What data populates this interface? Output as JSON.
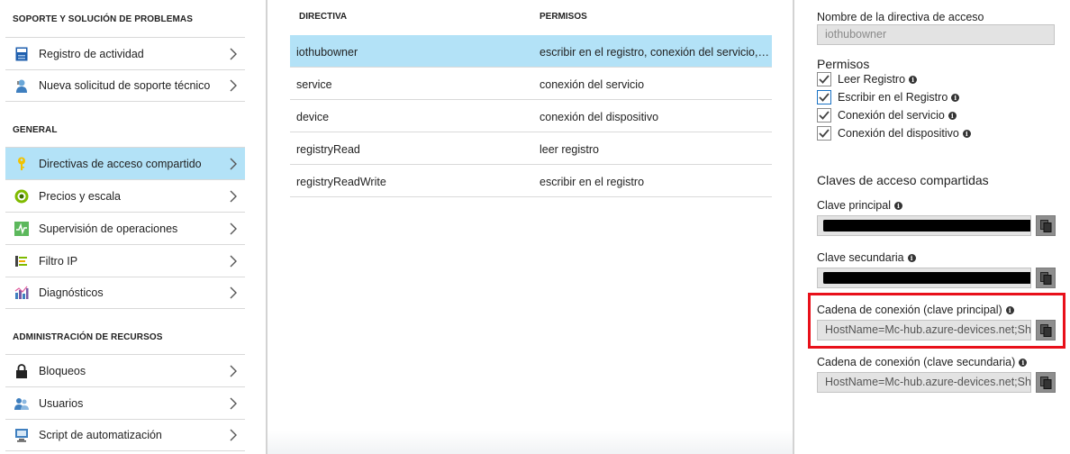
{
  "nav": {
    "sections": [
      {
        "title": "SOPORTE Y SOLUCIÓN DE PROBLEMAS",
        "items": [
          {
            "label": "Registro de actividad",
            "icon": "activity-log-icon"
          },
          {
            "label": "Nueva solicitud de soporte técnico",
            "icon": "support-request-icon"
          }
        ]
      },
      {
        "title": "GENERAL",
        "items": [
          {
            "label": "Directivas de acceso compartido",
            "icon": "key-icon",
            "active": true
          },
          {
            "label": "Precios y escala",
            "icon": "pricing-icon"
          },
          {
            "label": "Supervisión de operaciones",
            "icon": "monitoring-icon"
          },
          {
            "label": "Filtro IP",
            "icon": "ip-filter-icon"
          },
          {
            "label": "Diagnósticos",
            "icon": "diagnostics-icon"
          }
        ]
      },
      {
        "title": "ADMINISTRACIÓN DE RECURSOS",
        "items": [
          {
            "label": "Bloqueos",
            "icon": "lock-icon"
          },
          {
            "label": "Usuarios",
            "icon": "users-icon"
          },
          {
            "label": "Script de automatización",
            "icon": "automation-script-icon"
          }
        ]
      }
    ]
  },
  "table": {
    "headers": {
      "name": "DIRECTIVA",
      "permissions": "PERMISOS"
    },
    "rows": [
      {
        "name": "iothubowner",
        "permissions": "escribir en el registro, conexión del servicio, co..."
      },
      {
        "name": "service",
        "permissions": "conexión del servicio"
      },
      {
        "name": "device",
        "permissions": "conexión del dispositivo"
      },
      {
        "name": "registryRead",
        "permissions": "leer registro"
      },
      {
        "name": "registryReadWrite",
        "permissions": "escribir en el registro"
      }
    ],
    "selected_index": 0
  },
  "details": {
    "policy_name_label": "Nombre de la directiva de acceso",
    "policy_name_value": "iothubowner",
    "permissions_title": "Permisos",
    "permissions": [
      {
        "label": "Leer Registro",
        "checked": true
      },
      {
        "label": "Escribir en el Registro",
        "checked": true
      },
      {
        "label": "Conexión del servicio",
        "checked": true
      },
      {
        "label": "Conexión del dispositivo",
        "checked": true
      }
    ],
    "keys_title": "Claves de acceso compartidas",
    "primary_key_label": "Clave principal",
    "secondary_key_label": "Clave secundaria",
    "primary_conn_label": "Cadena de conexión (clave principal)",
    "primary_conn_value": "HostName=Mc-hub.azure-devices.net;Sha",
    "secondary_conn_label": "Cadena de conexión (clave secundaria)",
    "secondary_conn_value": "HostName=Mc-hub.azure-devices.net;Sha"
  },
  "colors": {
    "selection": "#b3e2f7",
    "highlight_border": "#e8101a",
    "check": "#1a72c4"
  }
}
